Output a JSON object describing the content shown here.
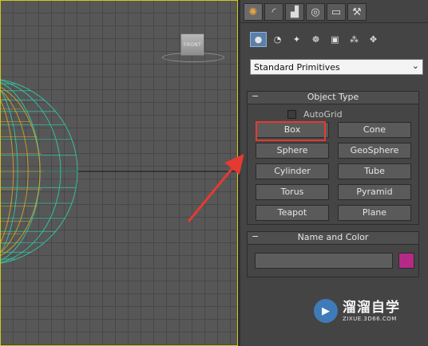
{
  "viewport": {
    "viewcube_label": "FRONT",
    "grid_color": "#484848",
    "sphere_wire_color": "#33c7a8",
    "selected_wire_color": "#d4a52a",
    "border_color": "#d0c81e"
  },
  "panel": {
    "tabs": [
      {
        "icon": "create-icon",
        "glyph": "✺"
      },
      {
        "icon": "modify-icon",
        "glyph": "◜"
      },
      {
        "icon": "hierarchy-icon",
        "glyph": "▟"
      },
      {
        "icon": "motion-icon",
        "glyph": "◎"
      },
      {
        "icon": "display-icon",
        "glyph": "▭"
      },
      {
        "icon": "utilities-icon",
        "glyph": "⚒"
      }
    ],
    "object_types": [
      {
        "icon": "geometry-icon",
        "glyph": "●"
      },
      {
        "icon": "shapes-icon",
        "glyph": "◔"
      },
      {
        "icon": "lights-icon",
        "glyph": "✦"
      },
      {
        "icon": "cameras-icon",
        "glyph": "☸"
      },
      {
        "icon": "helpers-icon",
        "glyph": "▣"
      },
      {
        "icon": "spacewarps-icon",
        "glyph": "⁂"
      },
      {
        "icon": "systems-icon",
        "glyph": "✥"
      }
    ],
    "category_dropdown": "Standard Primitives",
    "object_type": {
      "title": "Object Type",
      "toggle": "−",
      "autogrid_label": "AutoGrid",
      "buttons": [
        "Box",
        "Cone",
        "Sphere",
        "GeoSphere",
        "Cylinder",
        "Tube",
        "Torus",
        "Pyramid",
        "Teapot",
        "Plane"
      ]
    },
    "name_color": {
      "title": "Name and Color",
      "toggle": "−",
      "name_value": "",
      "color": "#b52a86"
    }
  },
  "annotation": {
    "highlight_color": "#e53a32"
  },
  "watermark": {
    "title": "溜溜自学",
    "url": "ZIXUE.3D66.COM"
  }
}
